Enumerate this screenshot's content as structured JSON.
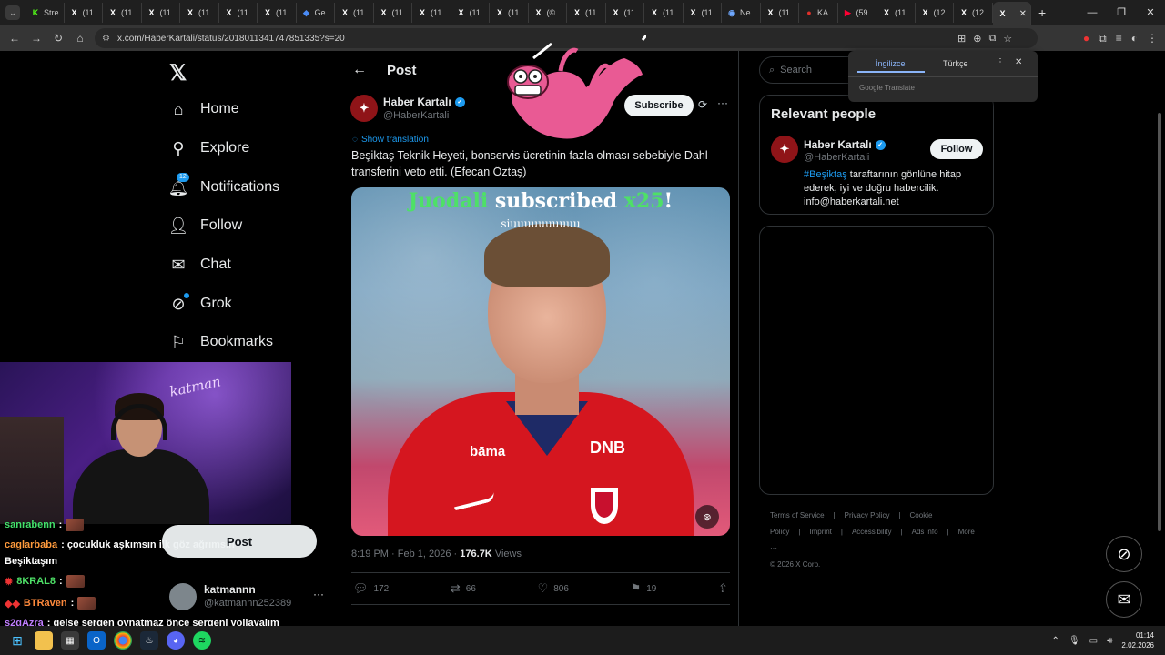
{
  "browser": {
    "tabs": [
      {
        "fav": "K",
        "label": "Stre",
        "color": "#53fc18"
      },
      {
        "fav": "X",
        "label": "(11",
        "color": "#ffffff"
      },
      {
        "fav": "X",
        "label": "(11",
        "color": "#ffffff"
      },
      {
        "fav": "X",
        "label": "(11",
        "color": "#ffffff"
      },
      {
        "fav": "X",
        "label": "(11",
        "color": "#ffffff"
      },
      {
        "fav": "X",
        "label": "(11",
        "color": "#ffffff"
      },
      {
        "fav": "X",
        "label": "(11",
        "color": "#ffffff"
      },
      {
        "fav": "◆",
        "label": "Ge",
        "color": "#4a8bf5"
      },
      {
        "fav": "X",
        "label": "(11",
        "color": "#ffffff"
      },
      {
        "fav": "X",
        "label": "(11",
        "color": "#ffffff"
      },
      {
        "fav": "X",
        "label": "(11",
        "color": "#ffffff"
      },
      {
        "fav": "X",
        "label": "(11",
        "color": "#ffffff"
      },
      {
        "fav": "X",
        "label": "(11",
        "color": "#ffffff"
      },
      {
        "fav": "X",
        "label": "(©",
        "color": "#ffffff"
      },
      {
        "fav": "X",
        "label": "(11",
        "color": "#ffffff"
      },
      {
        "fav": "X",
        "label": "(11",
        "color": "#ffffff"
      },
      {
        "fav": "X",
        "label": "(11",
        "color": "#ffffff"
      },
      {
        "fav": "X",
        "label": "(11",
        "color": "#ffffff"
      },
      {
        "fav": "◉",
        "label": "Ne",
        "color": "#6fa8ff"
      },
      {
        "fav": "X",
        "label": "(11",
        "color": "#ffffff"
      },
      {
        "fav": "●",
        "label": "KA",
        "color": "#e0302a"
      },
      {
        "fav": "▶",
        "label": "(59",
        "color": "#ff0033"
      },
      {
        "fav": "X",
        "label": "(11",
        "color": "#ffffff"
      },
      {
        "fav": "X",
        "label": "(12",
        "color": "#ffffff"
      },
      {
        "fav": "X",
        "label": "(12",
        "color": "#ffffff"
      },
      {
        "fav": "X",
        "label": "",
        "color": "#ffffff",
        "active": true
      }
    ],
    "url": "x.com/HaberKartali/status/2018011341747851335?s=20"
  },
  "translate_popup": {
    "tab_source": "İngilizce",
    "tab_target": "Türkçe",
    "footer": "Google Translate"
  },
  "nav": {
    "items": [
      {
        "label": "Home",
        "icon": "home-icon"
      },
      {
        "label": "Explore",
        "icon": "search-icon"
      },
      {
        "label": "Notifications",
        "icon": "bell-icon",
        "badge": "12"
      },
      {
        "label": "Follow",
        "icon": "person-add-icon"
      },
      {
        "label": "Chat",
        "icon": "mail-icon"
      },
      {
        "label": "Grok",
        "icon": "grok-icon"
      },
      {
        "label": "Bookmarks",
        "icon": "bookmark-icon"
      }
    ],
    "post_button": "Post"
  },
  "post": {
    "header_title": "Post",
    "author_name": "Haber Kartalı",
    "author_handle": "@HaberKartali",
    "subscribe_label": "Subscribe",
    "show_translation": "Show translation",
    "text": "Beşiktaş Teknik Heyeti, bonservis ücretinin fazla olması sebebiyle Dahl transferini veto etti. (Efecan Öztaş)",
    "media_overlay": {
      "user": "Juodali",
      "action": "subscribed",
      "count": "x25",
      "bang": "!",
      "message": "siuuuuuuuuuu"
    },
    "jersey_brand": "bāma",
    "jersey_sponsor": "DNB",
    "time": "8:19 PM",
    "sep": "·",
    "date": "Feb 1, 2026",
    "views_count": "176.7K",
    "views_label": "Views",
    "replies": "172",
    "reposts": "66",
    "likes": "806",
    "bookmarks": "19"
  },
  "sidebar": {
    "search_placeholder": "Search",
    "relevant_title": "Relevant people",
    "person_name": "Haber Kartalı",
    "person_handle": "@HaberKartali",
    "follow_label": "Follow",
    "bio_tag": "#Beşiktaş",
    "bio_rest": " taraftarının gönlüne hitap ederek, iyi ve doğru habercilik. info@haberkartali.net",
    "footer_links": [
      "Terms of Service",
      "|",
      "Privacy Policy",
      "|",
      "Cookie Policy",
      "|",
      "Imprint",
      "|",
      "Accessibility",
      "|",
      "Ads info",
      "|",
      "More ···"
    ],
    "copyright": "© 2026 X Corp."
  },
  "account": {
    "name": "katmannn",
    "handle": "@katmannn252389"
  },
  "stream": {
    "neon_sign": "katman",
    "chat": [
      {
        "user": "sanrabenn",
        "text": " :",
        "cls": "u1",
        "prefix": ""
      },
      {
        "user": "caglarbaba",
        "text": " : çocukluk aşkımsın ilk göz ağrımsın",
        "cls": "u2",
        "prefix": ""
      },
      {
        "user": "",
        "text": "Beşiktaşım",
        "cls": "u2",
        "prefix": ""
      },
      {
        "user": "8KRAL8",
        "text": " :",
        "cls": "u3",
        "prefix": "✹"
      },
      {
        "user": "BTRaven",
        "text": " :",
        "cls": "u4",
        "prefix": "◆◆"
      },
      {
        "user": "s2gAzra",
        "text": " : gelse sergen oynatmaz önce sergeni yollayalım",
        "cls": "u5",
        "prefix": ""
      }
    ]
  },
  "taskbar": {
    "time": "01:14",
    "date": "2.02.2026"
  },
  "colors": {
    "accent": "#1d9bf0",
    "brand_red": "#8f1418",
    "jacket": "#d5161f"
  }
}
